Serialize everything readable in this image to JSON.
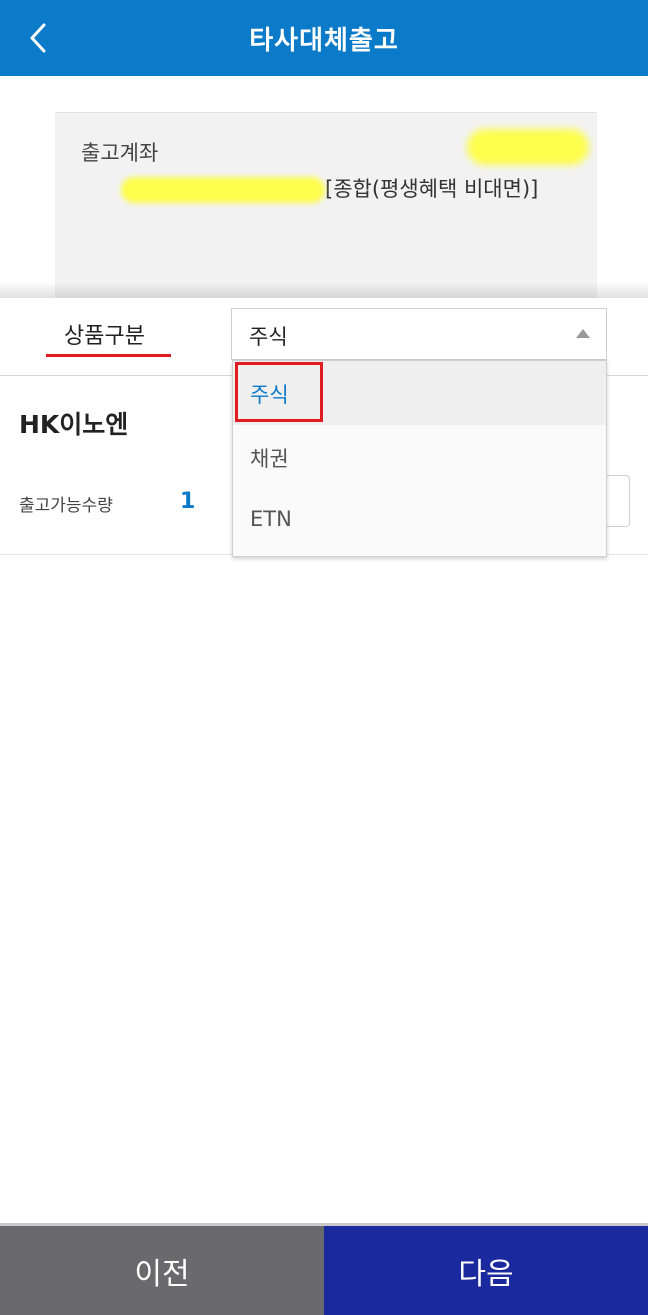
{
  "header": {
    "title": "타사대체출고",
    "back_icon": "chevron-left-icon"
  },
  "account": {
    "label": "출고계좌",
    "type_text": "[종합(평생혜택 비대면)]"
  },
  "selector": {
    "label": "상품구분",
    "selected_value": "주식",
    "options": [
      "주식",
      "채권",
      "ETN"
    ],
    "caret_icon": "caret-up-icon"
  },
  "item": {
    "name": "HK이노엔",
    "qty_label": "출고가능수량",
    "qty_value": "1"
  },
  "footer": {
    "prev_label": "이전",
    "next_label": "다음"
  },
  "colors": {
    "header_bg": "#0a7ac9",
    "accent_red": "#e01c22",
    "prev_bg": "#6a6a6c",
    "next_bg": "#1a2a9e",
    "highlight_yellow": "#ffff3a"
  }
}
